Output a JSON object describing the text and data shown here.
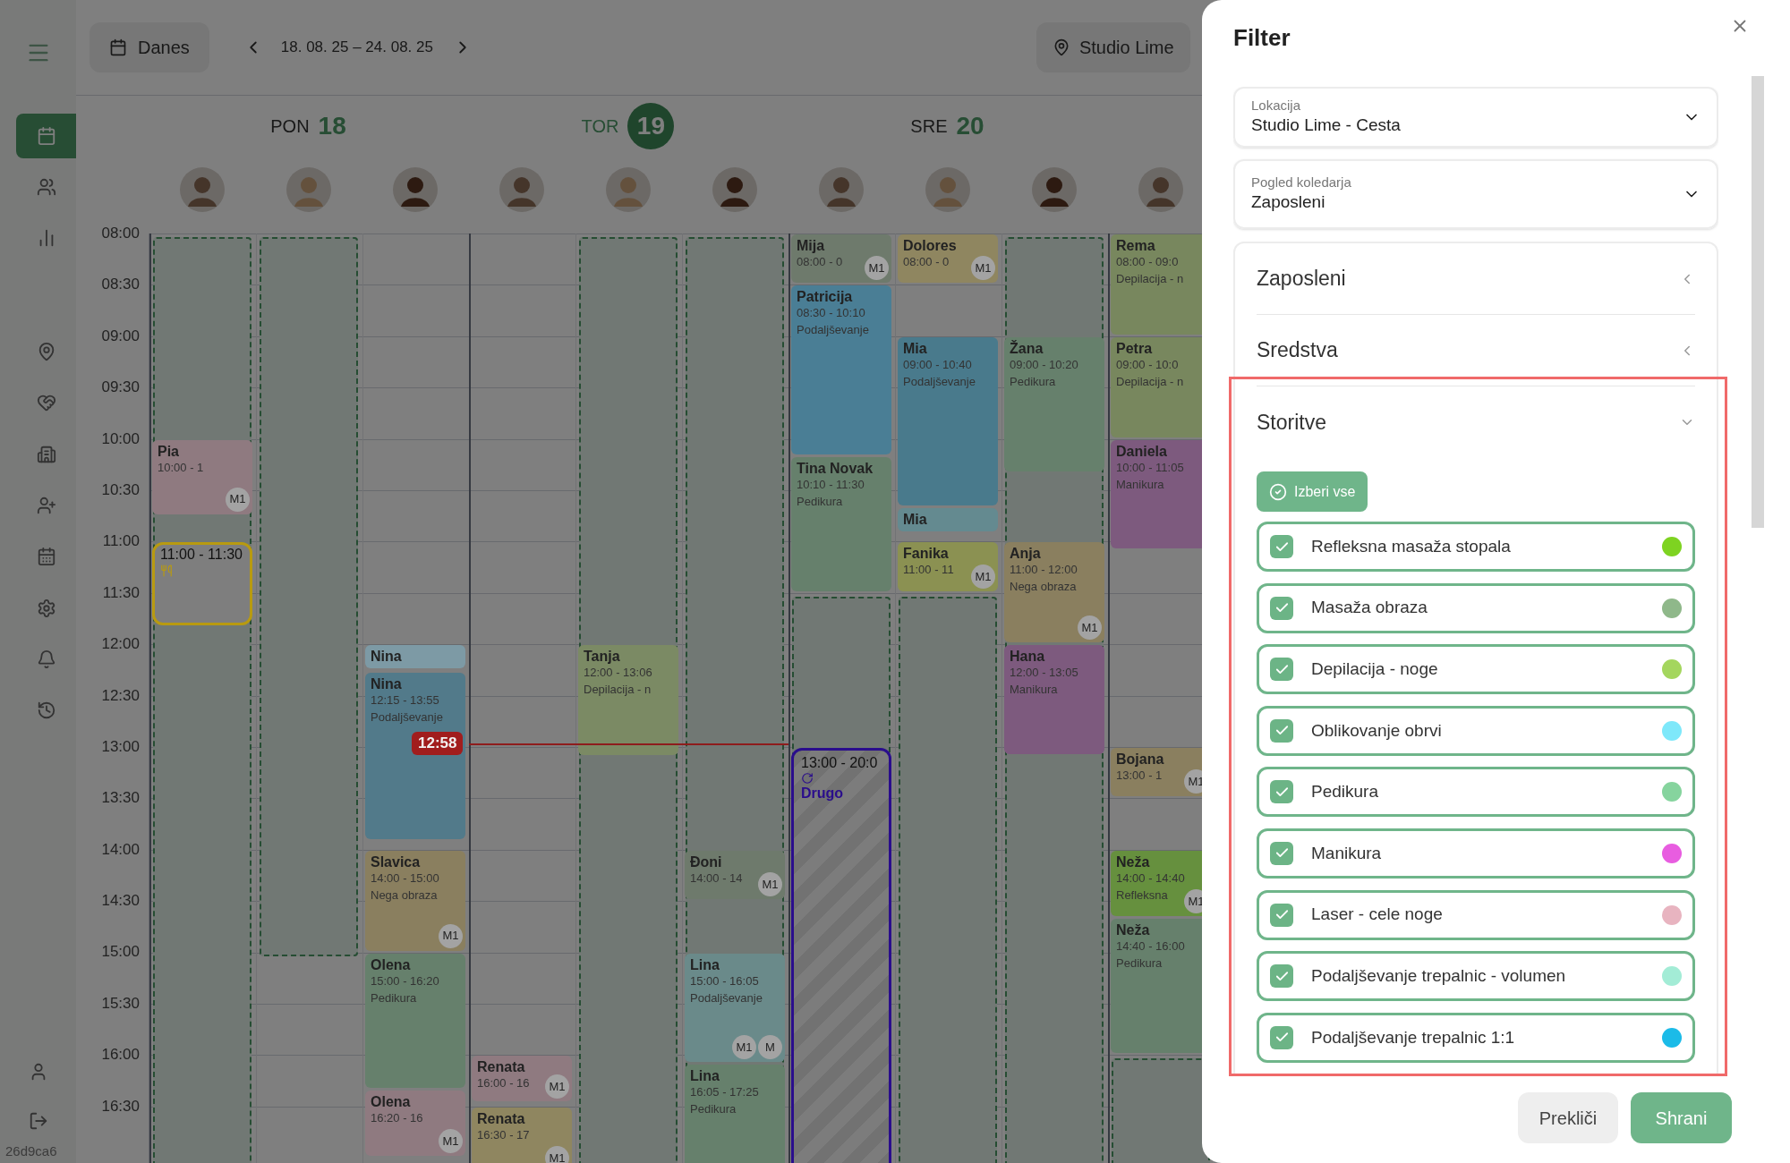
{
  "sidebar": {
    "items": [
      {
        "selected": true
      },
      {
        "selected": false
      },
      {
        "selected": false
      },
      {
        "selected": false
      },
      {
        "selected": false
      },
      {
        "selected": false
      },
      {
        "selected": false
      },
      {
        "selected": false
      },
      {
        "selected": false
      },
      {
        "selected": false
      },
      {
        "selected": false
      }
    ],
    "version": "26d9ca6"
  },
  "toolbar": {
    "today_button": "Danes",
    "date_range": "18. 08. 25 – 24. 08. 25",
    "location_button": "Studio Lime"
  },
  "days": [
    {
      "weekday": "PON",
      "date": "18",
      "selected": false
    },
    {
      "weekday": "TOR",
      "date": "19",
      "selected": true
    },
    {
      "weekday": "SRE",
      "date": "20",
      "selected": false
    }
  ],
  "time_labels": [
    "08:00",
    "08:30",
    "09:00",
    "09:30",
    "10:00",
    "10:30",
    "11:00",
    "11:30",
    "12:00",
    "12:30",
    "13:00",
    "13:30",
    "14:00",
    "14:30",
    "15:00",
    "15:30",
    "16:00",
    "16:30"
  ],
  "current_time": "12:58",
  "events": [
    {
      "kind": "appointment",
      "name": "Pia",
      "time": "10:00 - 1",
      "badges": [
        "M1"
      ],
      "color": "#8f7a80"
    },
    {
      "kind": "break",
      "time": "11:00 - 11:30",
      "color": "#b89a10"
    },
    {
      "kind": "appointment",
      "name": "Nina",
      "color": "#7d9aa5"
    },
    {
      "kind": "appointment",
      "name": "Nina",
      "time": "12:15 - 13:55",
      "service": "Podaljševanje",
      "color": "#527a8a"
    },
    {
      "kind": "appointment",
      "name": "Slavica",
      "time": "14:00 - 15:00",
      "service": "Nega obraza",
      "badges": [
        "M1"
      ],
      "color": "#8a7f5f"
    },
    {
      "kind": "appointment",
      "name": "Olena",
      "time": "15:00 - 16:20",
      "service": "Pedikura",
      "color": "#66806c"
    },
    {
      "kind": "appointment",
      "name": "Olena",
      "time": "16:20 - 16",
      "badges": [
        "M1"
      ],
      "color": "#8f7a80"
    },
    {
      "kind": "appointment",
      "name": "Renata",
      "time": "16:00 - 16",
      "badges": [
        "M1"
      ],
      "color": "#8f7a80"
    },
    {
      "kind": "appointment",
      "name": "Renata",
      "time": "16:30 - 17",
      "badges": [
        "M1"
      ],
      "color": "#8f8660"
    },
    {
      "kind": "appointment",
      "name": "Tanja",
      "time": "12:00 - 13:06",
      "service": "Depilacija - n",
      "color": "#7b8a64"
    },
    {
      "kind": "appointment",
      "name": "Đoni",
      "time": "14:00 - 14",
      "badges": [
        "M1"
      ],
      "color": "#6e7a6c"
    },
    {
      "kind": "appointment",
      "name": "Lina",
      "time": "15:00 - 16:05",
      "service": "Podaljševanje",
      "badges": [
        "M1",
        "M"
      ],
      "color": "#6a8a8a"
    },
    {
      "kind": "appointment",
      "name": "Lina",
      "time": "16:05 - 17:25",
      "service": "Pedikura",
      "color": "#66806c"
    },
    {
      "kind": "appointment",
      "name": "Mija",
      "time": "08:00 - 0",
      "badges": [
        "M1"
      ],
      "color": "#6e7a6c"
    },
    {
      "kind": "appointment",
      "name": "Patricija",
      "time": "08:30 - 10:10",
      "service": "Podaljševanje",
      "color": "#4a7e95"
    },
    {
      "kind": "appointment",
      "name": "Tina Novak",
      "time": "10:10 - 11:30",
      "service": "Pedikura",
      "color": "#66806c"
    },
    {
      "kind": "blocked",
      "time": "13:00 - 20:0",
      "label": "Drugo",
      "color": "#2a0d8c"
    },
    {
      "kind": "appointment",
      "name": "Dolores",
      "time": "08:00 - 0",
      "badges": [
        "M1"
      ],
      "color": "#8f8660"
    },
    {
      "kind": "appointment",
      "name": "Mia",
      "time": "09:00 - 10:40",
      "service": "Podaljševanje",
      "color": "#497a8c"
    },
    {
      "kind": "appointment",
      "name": "Mia",
      "color": "#648a90"
    },
    {
      "kind": "appointment",
      "name": "Fanika",
      "time": "11:00 - 11",
      "badges": [
        "M1"
      ],
      "color": "#8b9152"
    },
    {
      "kind": "appointment",
      "name": "Žana",
      "time": "09:00 - 10:20",
      "service": "Pedikura",
      "color": "#66806c"
    },
    {
      "kind": "appointment",
      "name": "Anja",
      "time": "11:00 - 12:00",
      "service": "Nega obraza",
      "badges": [
        "M1"
      ],
      "color": "#8a7f5f"
    },
    {
      "kind": "appointment",
      "name": "Hana",
      "time": "12:00 - 13:05",
      "service": "Manikura",
      "color": "#7d5a7e"
    },
    {
      "kind": "appointment",
      "name": "Rema",
      "time": "08:00 - 09:0",
      "service": "Depilacija - n",
      "color": "#78875e"
    },
    {
      "kind": "appointment",
      "name": "Petra",
      "time": "09:00 - 10:0",
      "service": "Depilacija - n",
      "color": "#78875e"
    },
    {
      "kind": "appointment",
      "name": "Daniela",
      "time": "10:00 - 11:05",
      "service": "Manikura",
      "color": "#7d5a7e"
    },
    {
      "kind": "appointment",
      "name": "Bojana",
      "time": "13:00 - 1",
      "badges": [
        "M1"
      ],
      "color": "#8a7f5f"
    },
    {
      "kind": "appointment",
      "name": "Neža",
      "time": "14:00 - 14:40",
      "service": "Refleksna",
      "badges": [
        "M1"
      ],
      "color": "#66903e"
    },
    {
      "kind": "appointment",
      "name": "Neža",
      "time": "14:40 - 16:00",
      "service": "Pedikura",
      "color": "#66806c"
    }
  ],
  "filter": {
    "title": "Filter",
    "location": {
      "label": "Lokacija",
      "value": "Studio Lime - Cesta"
    },
    "calendar_view": {
      "label": "Pogled koledarja",
      "value": "Zaposleni"
    },
    "sections": [
      {
        "title": "Zaposleni",
        "expanded": false
      },
      {
        "title": "Sredstva",
        "expanded": false
      },
      {
        "title": "Storitve",
        "expanded": true
      }
    ],
    "select_all": "Izberi vse",
    "services": [
      {
        "label": "Refleksna masaža stopala",
        "checked": true,
        "color": "#7ed321"
      },
      {
        "label": "Masaža obraza",
        "checked": true,
        "color": "#8fb88a"
      },
      {
        "label": "Depilacija - noge",
        "checked": true,
        "color": "#a4d65e"
      },
      {
        "label": "Oblikovanje obrvi",
        "checked": true,
        "color": "#7ee8fa"
      },
      {
        "label": "Pedikura",
        "checked": true,
        "color": "#86d49e"
      },
      {
        "label": "Manikura",
        "checked": true,
        "color": "#e85de0"
      },
      {
        "label": "Laser - cele noge",
        "checked": true,
        "color": "#e8b4c0"
      },
      {
        "label": "Podaljševanje trepalnic - volumen",
        "checked": true,
        "color": "#a3ecd6"
      },
      {
        "label": "Podaljševanje trepalnic 1:1",
        "checked": true,
        "color": "#1bbbe8"
      }
    ],
    "cancel": "Prekliči",
    "save": "Shrani"
  }
}
